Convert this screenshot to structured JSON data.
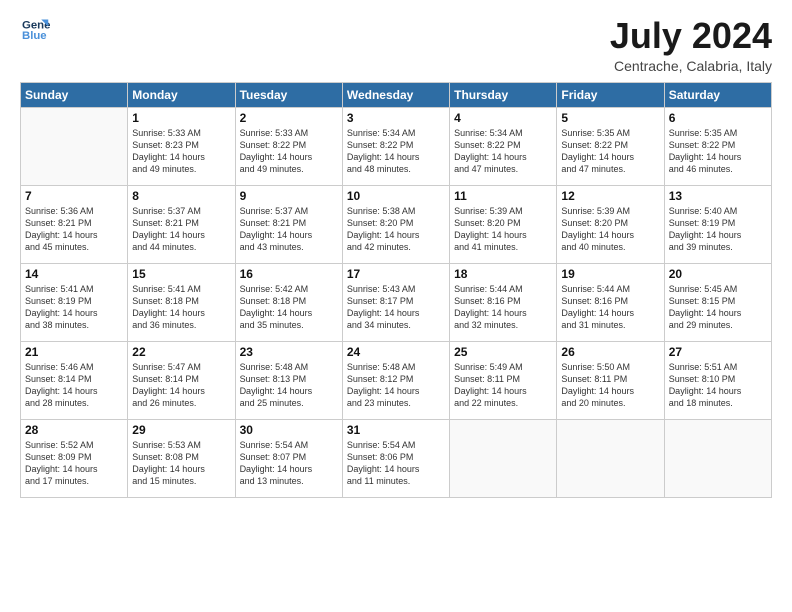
{
  "logo": {
    "line1": "General",
    "line2": "Blue"
  },
  "title": "July 2024",
  "subtitle": "Centrache, Calabria, Italy",
  "weekdays": [
    "Sunday",
    "Monday",
    "Tuesday",
    "Wednesday",
    "Thursday",
    "Friday",
    "Saturday"
  ],
  "weeks": [
    [
      {
        "day": "",
        "info": ""
      },
      {
        "day": "1",
        "info": "Sunrise: 5:33 AM\nSunset: 8:23 PM\nDaylight: 14 hours\nand 49 minutes."
      },
      {
        "day": "2",
        "info": "Sunrise: 5:33 AM\nSunset: 8:22 PM\nDaylight: 14 hours\nand 49 minutes."
      },
      {
        "day": "3",
        "info": "Sunrise: 5:34 AM\nSunset: 8:22 PM\nDaylight: 14 hours\nand 48 minutes."
      },
      {
        "day": "4",
        "info": "Sunrise: 5:34 AM\nSunset: 8:22 PM\nDaylight: 14 hours\nand 47 minutes."
      },
      {
        "day": "5",
        "info": "Sunrise: 5:35 AM\nSunset: 8:22 PM\nDaylight: 14 hours\nand 47 minutes."
      },
      {
        "day": "6",
        "info": "Sunrise: 5:35 AM\nSunset: 8:22 PM\nDaylight: 14 hours\nand 46 minutes."
      }
    ],
    [
      {
        "day": "7",
        "info": "Sunrise: 5:36 AM\nSunset: 8:21 PM\nDaylight: 14 hours\nand 45 minutes."
      },
      {
        "day": "8",
        "info": "Sunrise: 5:37 AM\nSunset: 8:21 PM\nDaylight: 14 hours\nand 44 minutes."
      },
      {
        "day": "9",
        "info": "Sunrise: 5:37 AM\nSunset: 8:21 PM\nDaylight: 14 hours\nand 43 minutes."
      },
      {
        "day": "10",
        "info": "Sunrise: 5:38 AM\nSunset: 8:20 PM\nDaylight: 14 hours\nand 42 minutes."
      },
      {
        "day": "11",
        "info": "Sunrise: 5:39 AM\nSunset: 8:20 PM\nDaylight: 14 hours\nand 41 minutes."
      },
      {
        "day": "12",
        "info": "Sunrise: 5:39 AM\nSunset: 8:20 PM\nDaylight: 14 hours\nand 40 minutes."
      },
      {
        "day": "13",
        "info": "Sunrise: 5:40 AM\nSunset: 8:19 PM\nDaylight: 14 hours\nand 39 minutes."
      }
    ],
    [
      {
        "day": "14",
        "info": "Sunrise: 5:41 AM\nSunset: 8:19 PM\nDaylight: 14 hours\nand 38 minutes."
      },
      {
        "day": "15",
        "info": "Sunrise: 5:41 AM\nSunset: 8:18 PM\nDaylight: 14 hours\nand 36 minutes."
      },
      {
        "day": "16",
        "info": "Sunrise: 5:42 AM\nSunset: 8:18 PM\nDaylight: 14 hours\nand 35 minutes."
      },
      {
        "day": "17",
        "info": "Sunrise: 5:43 AM\nSunset: 8:17 PM\nDaylight: 14 hours\nand 34 minutes."
      },
      {
        "day": "18",
        "info": "Sunrise: 5:44 AM\nSunset: 8:16 PM\nDaylight: 14 hours\nand 32 minutes."
      },
      {
        "day": "19",
        "info": "Sunrise: 5:44 AM\nSunset: 8:16 PM\nDaylight: 14 hours\nand 31 minutes."
      },
      {
        "day": "20",
        "info": "Sunrise: 5:45 AM\nSunset: 8:15 PM\nDaylight: 14 hours\nand 29 minutes."
      }
    ],
    [
      {
        "day": "21",
        "info": "Sunrise: 5:46 AM\nSunset: 8:14 PM\nDaylight: 14 hours\nand 28 minutes."
      },
      {
        "day": "22",
        "info": "Sunrise: 5:47 AM\nSunset: 8:14 PM\nDaylight: 14 hours\nand 26 minutes."
      },
      {
        "day": "23",
        "info": "Sunrise: 5:48 AM\nSunset: 8:13 PM\nDaylight: 14 hours\nand 25 minutes."
      },
      {
        "day": "24",
        "info": "Sunrise: 5:48 AM\nSunset: 8:12 PM\nDaylight: 14 hours\nand 23 minutes."
      },
      {
        "day": "25",
        "info": "Sunrise: 5:49 AM\nSunset: 8:11 PM\nDaylight: 14 hours\nand 22 minutes."
      },
      {
        "day": "26",
        "info": "Sunrise: 5:50 AM\nSunset: 8:11 PM\nDaylight: 14 hours\nand 20 minutes."
      },
      {
        "day": "27",
        "info": "Sunrise: 5:51 AM\nSunset: 8:10 PM\nDaylight: 14 hours\nand 18 minutes."
      }
    ],
    [
      {
        "day": "28",
        "info": "Sunrise: 5:52 AM\nSunset: 8:09 PM\nDaylight: 14 hours\nand 17 minutes."
      },
      {
        "day": "29",
        "info": "Sunrise: 5:53 AM\nSunset: 8:08 PM\nDaylight: 14 hours\nand 15 minutes."
      },
      {
        "day": "30",
        "info": "Sunrise: 5:54 AM\nSunset: 8:07 PM\nDaylight: 14 hours\nand 13 minutes."
      },
      {
        "day": "31",
        "info": "Sunrise: 5:54 AM\nSunset: 8:06 PM\nDaylight: 14 hours\nand 11 minutes."
      },
      {
        "day": "",
        "info": ""
      },
      {
        "day": "",
        "info": ""
      },
      {
        "day": "",
        "info": ""
      }
    ]
  ]
}
